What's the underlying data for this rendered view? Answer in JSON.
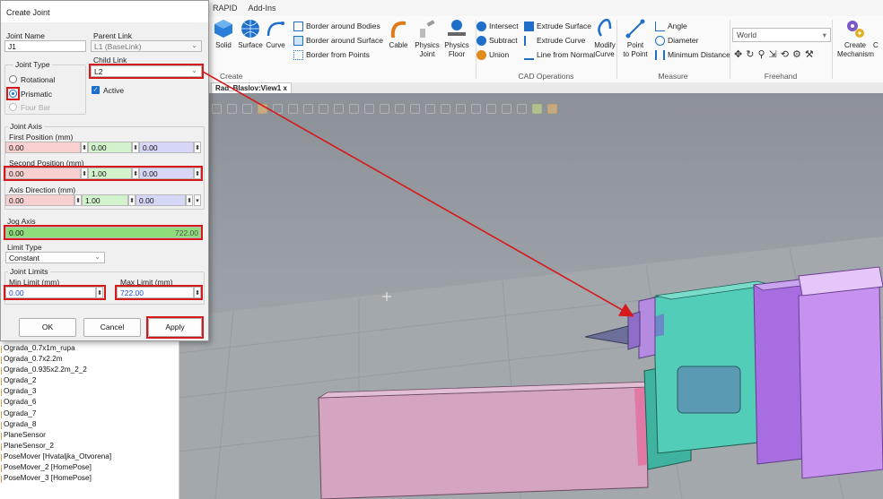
{
  "ribbon": {
    "tabs": [
      "RAPID",
      "Add-Ins"
    ],
    "create_group": {
      "label": "Create",
      "solid": "Solid",
      "surface": "Surface",
      "curve": "Curve",
      "border_bodies": "Border around Bodies",
      "border_surface": "Border around Surface",
      "border_points": "Border from Points",
      "cable": "Cable",
      "physics_joint_1": "Physics",
      "physics_joint_2": "Joint",
      "physics_floor_1": "Physics",
      "physics_floor_2": "Floor"
    },
    "cad_group": {
      "label": "CAD Operations",
      "intersect": "Intersect",
      "subtract": "Subtract",
      "union": "Union",
      "extrude_surface": "Extrude Surface",
      "extrude_curve": "Extrude Curve",
      "line_from_normal": "Line from Normal",
      "modify_curve_1": "Modify",
      "modify_curve_2": "Curve"
    },
    "measure_group": {
      "label": "Measure",
      "point_to_point_1": "Point",
      "point_to_point_2": "to Point",
      "angle": "Angle",
      "diameter": "Diameter",
      "min_distance": "Minimum Distance"
    },
    "freehand_group": {
      "label": "Freehand",
      "world_value": "World"
    },
    "mechanism_group": {
      "create_1": "Create",
      "create_2": "Mechanism",
      "overflow": "C"
    }
  },
  "document_tab": {
    "label": "Rad_Blaslov:View1",
    "close": "x"
  },
  "dialog": {
    "title": "Create Joint",
    "joint_name_label": "Joint Name",
    "joint_name_value": "J1",
    "parent_link_label": "Parent Link",
    "parent_link_value": "L1 (BaseLink)",
    "child_link_label": "Child Link",
    "child_link_value": "L2",
    "joint_type_label": "Joint Type",
    "joint_types": [
      "Rotational",
      "Prismatic",
      "Four Bar"
    ],
    "joint_type_selected": "Prismatic",
    "active_label": "Active",
    "joint_axis_label": "Joint Axis",
    "first_position_label": "First Position (mm)",
    "first_position": [
      "0.00",
      "0.00",
      "0.00"
    ],
    "second_position_label": "Second Position (mm)",
    "second_position": [
      "0.00",
      "1.00",
      "0.00"
    ],
    "axis_direction_label": "Axis Direction (mm)",
    "axis_direction": [
      "0.00",
      "1.00",
      "0.00"
    ],
    "jog_axis_label": "Jog Axis",
    "jog_axis_min": "0.00",
    "jog_axis_max": "722.00",
    "jog_axis_fill_fraction": 1.0,
    "limit_type_label": "Limit Type",
    "limit_type_value": "Constant",
    "joint_limits_label": "Joint Limits",
    "min_limit_label": "Min Limit (mm)",
    "min_limit_value": "0.00",
    "max_limit_label": "Max Limit (mm)",
    "max_limit_value": "722.00",
    "ok_label": "OK",
    "cancel_label": "Cancel",
    "apply_label": "Apply"
  },
  "tree": {
    "items": [
      "Ograda_0.7x1m_rupa",
      "Ograda_0.7x2.2m",
      "Ograda_0.935x2.2m_2_2",
      "Ograda_2",
      "Ograda_3",
      "Ograda_6",
      "Ograda_7",
      "Ograda_8",
      "PlaneSensor",
      "PlaneSensor_2",
      "PoseMover [Hvataljka_Otvorena]",
      "PoseMover_2 [HomePose]",
      "PoseMover_3 [HomePose]"
    ]
  },
  "colors": {
    "highlight": "#d6191c",
    "accent": "#1a6fd1",
    "jog_fill": "#8fdc7a",
    "machine_cyan": "#4fc9b4",
    "machine_violet": "#b97ee0",
    "floor_pink": "#d9a7c6"
  }
}
